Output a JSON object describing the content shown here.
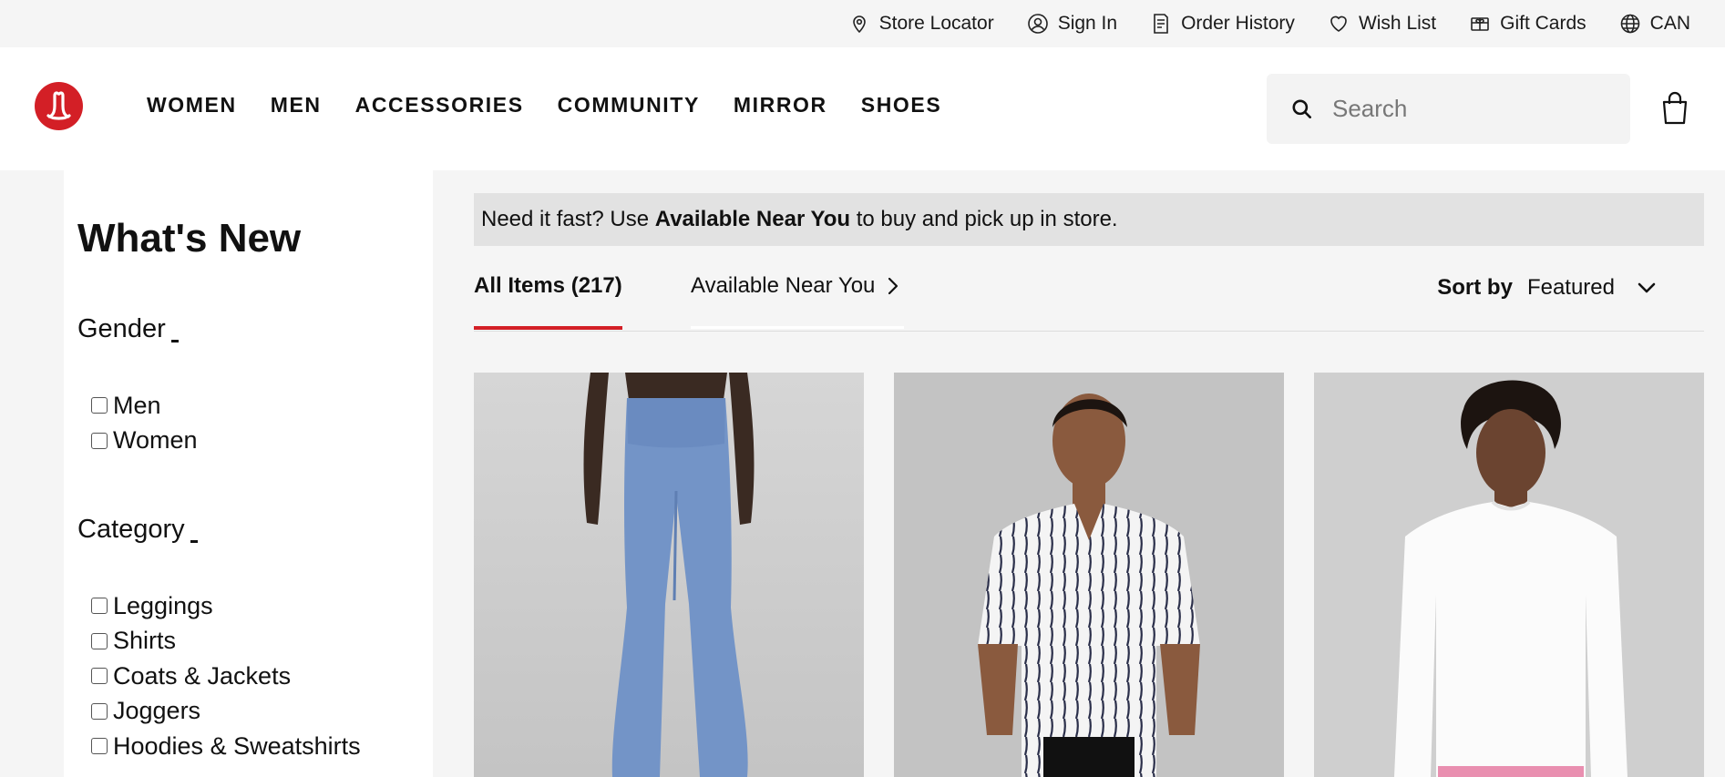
{
  "utility": {
    "store_locator": "Store Locator",
    "sign_in": "Sign In",
    "order_history": "Order History",
    "wish_list": "Wish List",
    "gift_cards": "Gift Cards",
    "region": "CAN"
  },
  "header": {
    "nav": [
      "WOMEN",
      "MEN",
      "ACCESSORIES",
      "COMMUNITY",
      "MIRROR",
      "SHOES"
    ],
    "search_placeholder": "Search",
    "brand_color": "#d31f26"
  },
  "sidebar": {
    "title": "What's New",
    "gender": {
      "heading": "Gender",
      "options": [
        "Men",
        "Women"
      ]
    },
    "category": {
      "heading": "Category",
      "options": [
        "Leggings",
        "Shirts",
        "Coats & Jackets",
        "Joggers",
        "Hoodies & Sweatshirts"
      ]
    }
  },
  "main": {
    "banner": {
      "prefix": "Need it fast? Use ",
      "bold": "Available Near You",
      "suffix": " to buy and pick up in store."
    },
    "tabs": {
      "all_items": "All Items (217)",
      "available_near_you": "Available Near You"
    },
    "sort": {
      "label": "Sort by",
      "value": "Featured"
    },
    "products": [
      {
        "image": "blue flared leggings"
      },
      {
        "image": "white striped short-sleeve shirt"
      },
      {
        "image": "white long-sleeve tee"
      }
    ]
  }
}
